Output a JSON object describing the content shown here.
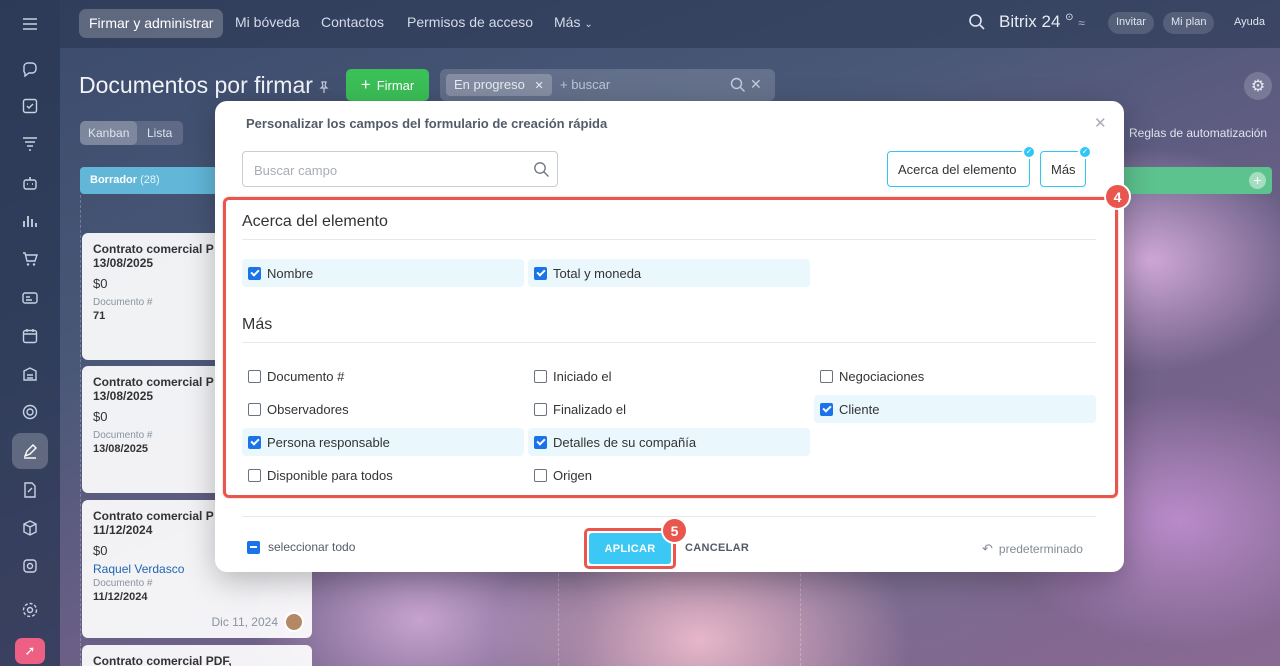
{
  "topbar": {
    "nav": [
      "Firmar y administrar",
      "Mi bóveda",
      "Contactos",
      "Permisos de acceso",
      "Más"
    ],
    "brand": "Bitrix 24",
    "pills": [
      "Invitar",
      "Mi plan",
      "Ayuda"
    ]
  },
  "header": {
    "title": "Documentos por firmar",
    "sign_button": "Firmar",
    "filter_chip": "En progreso",
    "filter_placeholder": "+ buscar",
    "views": [
      "Kanban",
      "Lista"
    ],
    "automation": "Reglas de automatización"
  },
  "kanban": {
    "column_title": "Borrador",
    "column_count": "(28)",
    "cards": [
      {
        "title": "Contrato comercial P",
        "date_line": "13/08/2025",
        "amount": "$0",
        "field_label": "Documento #",
        "field_value": "71"
      },
      {
        "title": "Contrato comercial P",
        "date_line": "13/08/2025",
        "amount": "$0",
        "field_label": "Documento #",
        "field_value": "13/08/2025"
      },
      {
        "title": "Contrato comercial P",
        "date_line": "11/12/2024",
        "amount": "$0",
        "link": "Raquel Verdasco",
        "field_label": "Documento #",
        "field_value": "11/12/2024",
        "footer_date": "Dic 11, 2024"
      },
      {
        "title": "Contrato comercial PDF,"
      }
    ]
  },
  "modal": {
    "title": "Personalizar los campos del formulario de creación rápida",
    "search_placeholder": "Buscar campo",
    "section_tags": [
      "Acerca del elemento",
      "Más"
    ],
    "sections": [
      {
        "heading": "Acerca del elemento",
        "fields": [
          {
            "label": "Nombre",
            "checked": true
          },
          {
            "label": "Total y moneda",
            "checked": true
          }
        ]
      },
      {
        "heading": "Más",
        "fields": [
          {
            "label": "Documento #",
            "checked": false
          },
          {
            "label": "Iniciado el",
            "checked": false
          },
          {
            "label": "Negociaciones",
            "checked": false
          },
          {
            "label": "Observadores",
            "checked": false
          },
          {
            "label": "Finalizado el",
            "checked": false
          },
          {
            "label": "Cliente",
            "checked": true
          },
          {
            "label": "Persona responsable",
            "checked": true
          },
          {
            "label": "Detalles de su compañía",
            "checked": true
          },
          {
            "label": "Disponible para todos",
            "checked": false
          },
          {
            "label": "Origen",
            "checked": false
          }
        ]
      }
    ],
    "select_all": "seleccionar todo",
    "apply": "APLICAR",
    "cancel": "CANCELAR",
    "default": "predeterminado"
  },
  "annotations": {
    "step_fields": "4",
    "step_apply": "5"
  },
  "colors": {
    "accent": "#3bc8f5",
    "highlight": "#e9564d",
    "checkbox": "#1a73e8"
  }
}
